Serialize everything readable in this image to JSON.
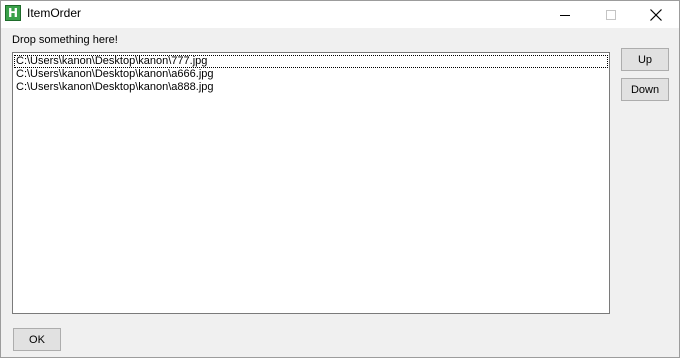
{
  "window": {
    "title": "ItemOrder",
    "icon": "app-h-icon",
    "icon_letter": "H"
  },
  "caption_buttons": {
    "minimize": "minimize-icon",
    "maximize": "maximize-icon",
    "close": "close-icon"
  },
  "drop_label": "Drop something here!",
  "list": {
    "items": [
      "C:\\Users\\kanon\\Desktop\\kanon\\777.jpg",
      "C:\\Users\\kanon\\Desktop\\kanon\\a666.jpg",
      "C:\\Users\\kanon\\Desktop\\kanon\\a888.jpg"
    ]
  },
  "buttons": {
    "up_label": "Up",
    "down_label": "Down",
    "ok_label": "OK"
  },
  "colors": {
    "icon_green": "#3aa14a",
    "window_bg": "#f0f0f0",
    "button_bg": "#e1e1e1"
  }
}
